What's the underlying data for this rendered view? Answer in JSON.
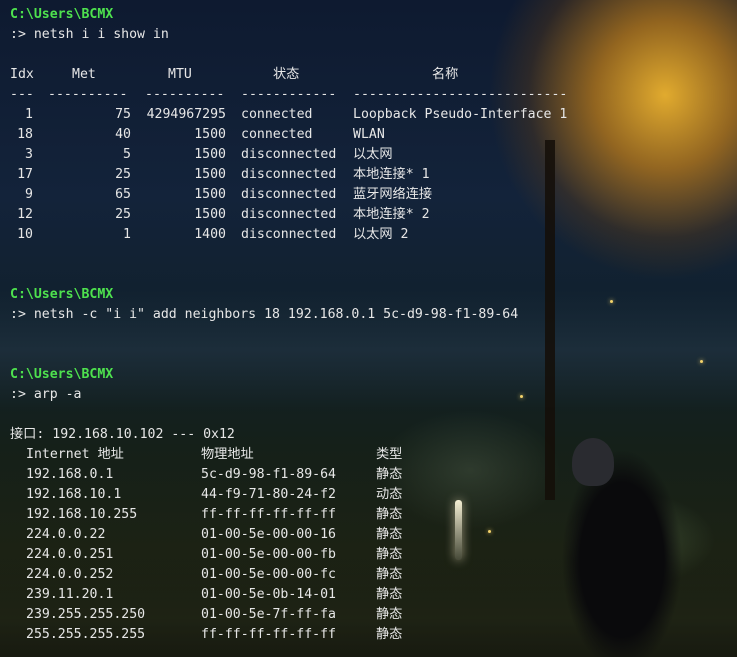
{
  "session1": {
    "prompt_path": "C:\\Users\\BCMX",
    "command": ":> netsh i i show in",
    "table": {
      "headers": {
        "idx": "Idx",
        "met": "Met",
        "mtu": "MTU",
        "state": "状态",
        "name": "名称"
      },
      "separator": {
        "idx": "---",
        "met": "----------",
        "mtu": "----------",
        "state": "------------",
        "name": "---------------------------"
      },
      "rows": [
        {
          "idx": "1",
          "met": "75",
          "mtu": "4294967295",
          "state": "connected",
          "name": "Loopback Pseudo-Interface 1"
        },
        {
          "idx": "18",
          "met": "40",
          "mtu": "1500",
          "state": "connected",
          "name": "WLAN"
        },
        {
          "idx": "3",
          "met": "5",
          "mtu": "1500",
          "state": "disconnected",
          "name": "以太网"
        },
        {
          "idx": "17",
          "met": "25",
          "mtu": "1500",
          "state": "disconnected",
          "name": "本地连接* 1"
        },
        {
          "idx": "9",
          "met": "65",
          "mtu": "1500",
          "state": "disconnected",
          "name": "蓝牙网络连接"
        },
        {
          "idx": "12",
          "met": "25",
          "mtu": "1500",
          "state": "disconnected",
          "name": "本地连接* 2"
        },
        {
          "idx": "10",
          "met": "1",
          "mtu": "1400",
          "state": "disconnected",
          "name": "以太网 2"
        }
      ]
    }
  },
  "session2": {
    "prompt_path": "C:\\Users\\BCMX",
    "command": ":> netsh -c \"i i\" add neighbors 18 192.168.0.1 5c-d9-98-f1-89-64"
  },
  "session3": {
    "prompt_path": "C:\\Users\\BCMX",
    "command": ":> arp -a",
    "interface_line": "接口: 192.168.10.102 --- 0x12",
    "table": {
      "headers": {
        "ip": "Internet 地址",
        "mac": "物理地址",
        "type": "类型"
      },
      "rows": [
        {
          "ip": "192.168.0.1",
          "mac": "5c-d9-98-f1-89-64",
          "type": "静态"
        },
        {
          "ip": "192.168.10.1",
          "mac": "44-f9-71-80-24-f2",
          "type": "动态"
        },
        {
          "ip": "192.168.10.255",
          "mac": "ff-ff-ff-ff-ff-ff",
          "type": "静态"
        },
        {
          "ip": "224.0.0.22",
          "mac": "01-00-5e-00-00-16",
          "type": "静态"
        },
        {
          "ip": "224.0.0.251",
          "mac": "01-00-5e-00-00-fb",
          "type": "静态"
        },
        {
          "ip": "224.0.0.252",
          "mac": "01-00-5e-00-00-fc",
          "type": "静态"
        },
        {
          "ip": "239.11.20.1",
          "mac": "01-00-5e-0b-14-01",
          "type": "静态"
        },
        {
          "ip": "239.255.255.250",
          "mac": "01-00-5e-7f-ff-fa",
          "type": "静态"
        },
        {
          "ip": "255.255.255.255",
          "mac": "ff-ff-ff-ff-ff-ff",
          "type": "静态"
        }
      ]
    }
  },
  "colors": {
    "prompt": "#4ee24e",
    "text": "#e7e7e7"
  }
}
